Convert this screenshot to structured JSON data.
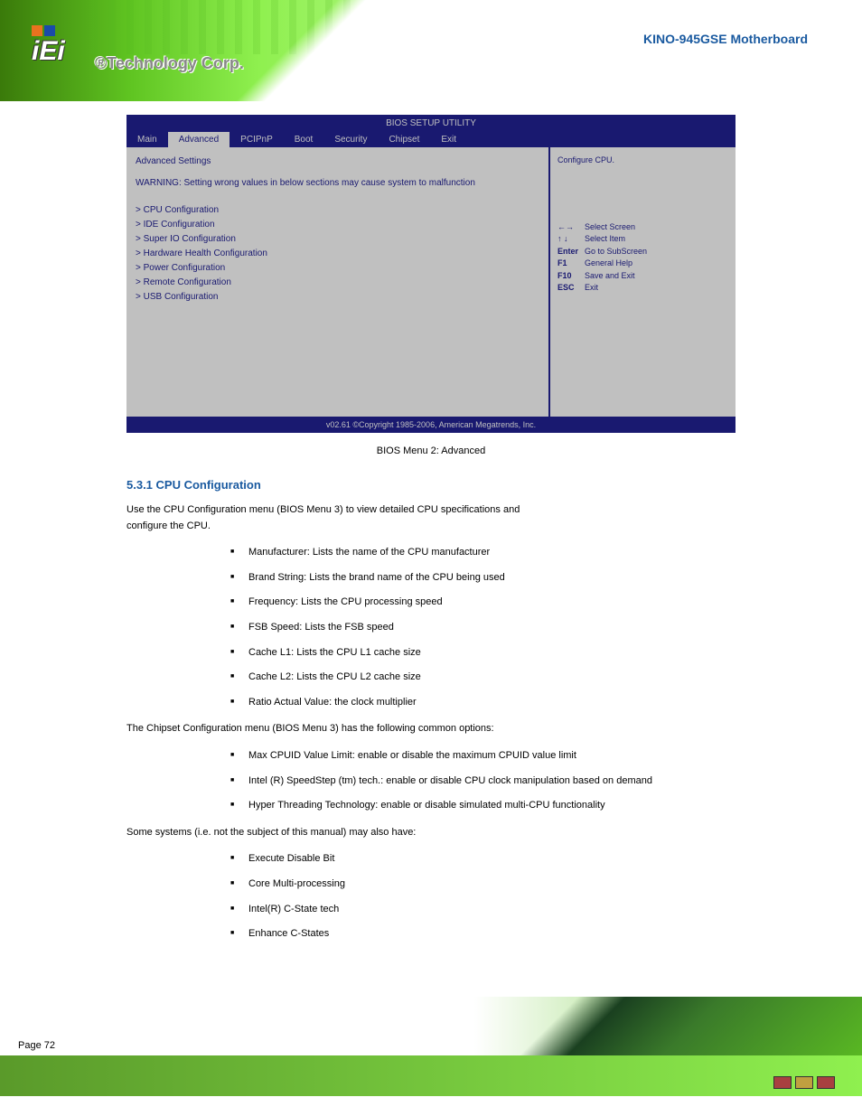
{
  "header": {
    "logo_text": "iEi",
    "company": "®Technology Corp.",
    "product": "KINO-945GSE Motherboard"
  },
  "bios": {
    "setup_title": "BIOS SETUP UTILITY",
    "tabs": [
      "Main",
      "Advanced",
      "PCIPnP",
      "Boot",
      "Security",
      "Chipset",
      "Exit"
    ],
    "active_tab": "Advanced",
    "section": "Advanced Settings",
    "warning": "WARNING: Setting wrong values in below sections may cause system to malfunction",
    "submenus": [
      "CPU Configuration",
      "IDE Configuration",
      "Super IO Configuration",
      "Hardware Health Configuration",
      "Power Configuration",
      "Remote Configuration",
      "USB Configuration"
    ],
    "help_title": "Configure CPU.",
    "help_keys": [
      {
        "k": "←→",
        "d": "Select Screen"
      },
      {
        "k": "↑ ↓",
        "d": "Select Item"
      },
      {
        "k": "Enter",
        "d": "Go to SubScreen"
      },
      {
        "k": "F1",
        "d": "General Help"
      },
      {
        "k": "F10",
        "d": "Save and Exit"
      },
      {
        "k": "ESC",
        "d": "Exit"
      }
    ],
    "copyright": "v02.61 ©Copyright 1985-2006, American Megatrends, Inc."
  },
  "caption": "BIOS Menu 2: Advanced",
  "section_title": "5.3.1 CPU Configuration",
  "intro_line1": "Use the CPU Configuration menu (BIOS Menu 3) to view detailed CPU specifications and",
  "intro_line2": "configure the CPU.",
  "cpu_items": [
    "Manufacturer: Lists the name of the CPU manufacturer",
    "Brand String: Lists the brand name of the CPU being used",
    "Frequency: Lists the CPU processing speed",
    "FSB Speed: Lists the FSB speed",
    "Cache L1: Lists the CPU L1 cache size",
    "Cache L2: Lists the CPU L2 cache size",
    "Ratio Actual Value: the clock multiplier"
  ],
  "chipset_title": "The Chipset Configuration menu (BIOS Menu 3) has the following common options:",
  "chipset_items": [
    "Max CPUID Value Limit: enable or disable the maximum CPUID value limit",
    "Intel (R) SpeedStep (tm) tech.: enable or disable CPU clock manipulation based on demand",
    "Hyper Threading Technology: enable or disable simulated multi-CPU functionality"
  ],
  "related_items": [
    "Execute Disable Bit",
    "Core Multi-processing",
    "Intel(R) C-State tech",
    "Enhance C-States"
  ],
  "page_number": "Page 72"
}
